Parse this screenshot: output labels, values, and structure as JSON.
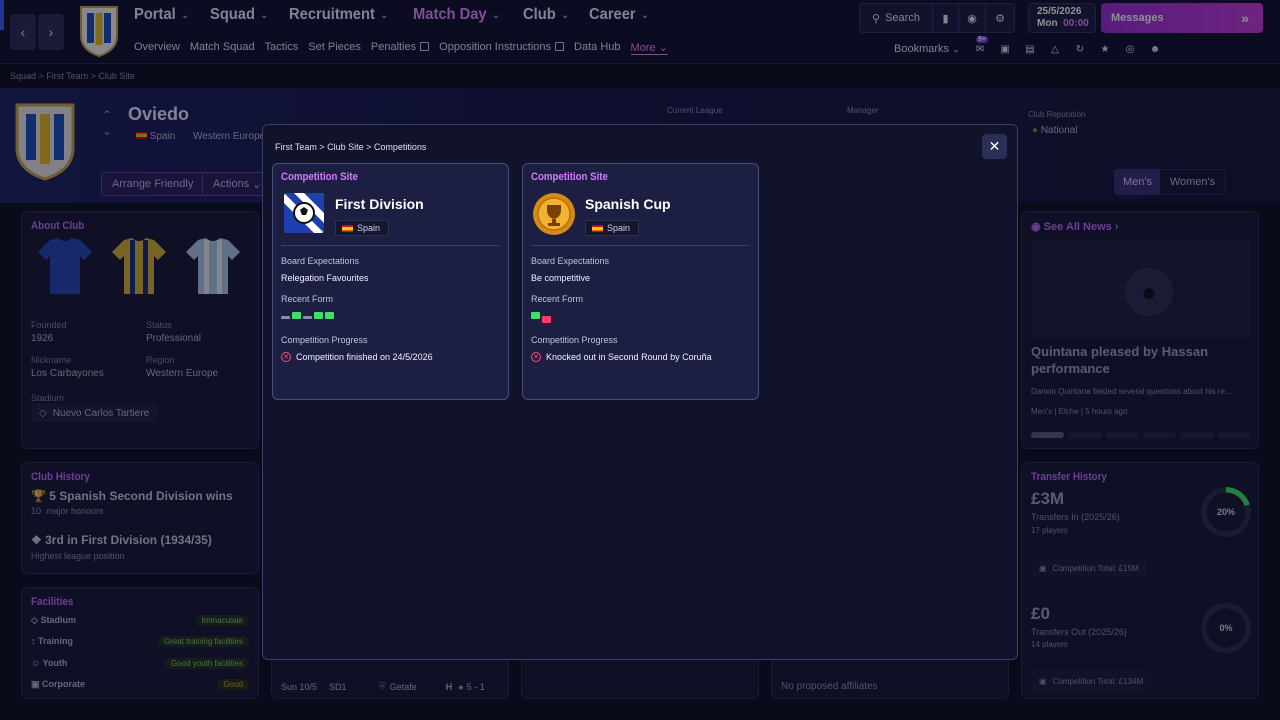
{
  "nav": {
    "main": [
      {
        "label": "Portal",
        "active": false
      },
      {
        "label": "Squad",
        "active": false
      },
      {
        "label": "Recruitment",
        "active": false
      },
      {
        "label": "Match Day",
        "active": true
      },
      {
        "label": "Club",
        "active": false
      },
      {
        "label": "Career",
        "active": false
      }
    ],
    "sub": [
      "Overview",
      "Match Squad",
      "Tactics",
      "Set Pieces",
      "Penalties",
      "Opposition Instructions",
      "Data Hub",
      "More"
    ],
    "search_label": "Search",
    "date": "25/5/2026",
    "day": "Mon",
    "time": "00:00",
    "messages_label": "Messages",
    "bookmarks_label": "Bookmarks",
    "notif_badge": "9+"
  },
  "breadcrumb": [
    "Squad",
    "First Team",
    "Club Site"
  ],
  "header": {
    "club_name": "Oviedo",
    "country": "Spain",
    "region": "Western Europe",
    "current_league_label": "Current League",
    "manager_label": "Manager",
    "reputation_label": "Club Reputation",
    "reputation_value": "National",
    "arrange_friendly": "Arrange Friendly",
    "actions": "Actions",
    "tab_mens": "Men's",
    "tab_womens": "Women's"
  },
  "about": {
    "title": "About Club",
    "founded_label": "Founded",
    "founded": "1926",
    "status_label": "Status",
    "status": "Professional",
    "nickname_label": "Nickname",
    "nickname": "Los Carbayones",
    "region_label": "Region",
    "region": "Western Europe",
    "stadium_label": "Stadium",
    "stadium": "Nuevo Carlos Tartiere"
  },
  "history": {
    "title": "Club History",
    "item1": "5 Spanish Second Division wins",
    "item1_sub_num": "10",
    "item1_sub": "major honours",
    "item2": "3rd in First Division (1934/35)",
    "item2_sub": "Highest league position"
  },
  "facilities": {
    "title": "Facilities",
    "rows": [
      {
        "label": "Stadium",
        "value": "Immaculate"
      },
      {
        "label": "Training",
        "value": "Great training facilities"
      },
      {
        "label": "Youth",
        "value": "Good youth facilities"
      },
      {
        "label": "Corporate",
        "value": "Good"
      }
    ]
  },
  "news": {
    "title": "See All News",
    "headline": "Quintana pleased by Hassan performance",
    "snippet": "Darwin Quintana fielded several questions about his re...",
    "tag1": "Men's",
    "tag2": "Elche",
    "time": "5 hours ago"
  },
  "transfers": {
    "title": "Transfer History",
    "in_amount": "£3M",
    "in_label": "Transfers In (2025/26)",
    "in_players": "17 players",
    "in_pct": "20%",
    "in_fraction": 0.2,
    "in_total": "Competition Total: £15M",
    "out_amount": "£0",
    "out_label": "Transfers Out (2025/26)",
    "out_players": "14 players",
    "out_pct": "0%",
    "out_fraction": 0,
    "out_total": "Competition Total: £134M"
  },
  "fixture": {
    "date": "Sun 10/5",
    "comp": "SD1",
    "opponent": "Getafe",
    "venue": "H",
    "score": "5 - 1"
  },
  "affiliates": "No proposed affiliates",
  "modal": {
    "breadcrumb": [
      "First Team",
      "Club Site",
      "Competitions"
    ],
    "cards": [
      {
        "title": "Competition Site",
        "name": "First Division",
        "country": "Spain",
        "board_label": "Board Expectations",
        "board_value": "Relegation Favourites",
        "form_label": "Recent Form",
        "form": [
          "D",
          "W",
          "D",
          "W",
          "W"
        ],
        "progress_label": "Competition Progress",
        "progress_value": "Competition finished on 24/5/2026"
      },
      {
        "title": "Competition Site",
        "name": "Spanish Cup",
        "country": "Spain",
        "board_label": "Board Expectations",
        "board_value": "Be competitive",
        "form_label": "Recent Form",
        "form": [
          "W",
          "L"
        ],
        "progress_label": "Competition Progress",
        "progress_value": "Knocked out in Second Round by Coruña"
      }
    ]
  },
  "colors": {
    "accent": "#c36bff",
    "win": "#3ee06a",
    "loss": "#ff3d6a",
    "draw": "#8a8ca8"
  }
}
